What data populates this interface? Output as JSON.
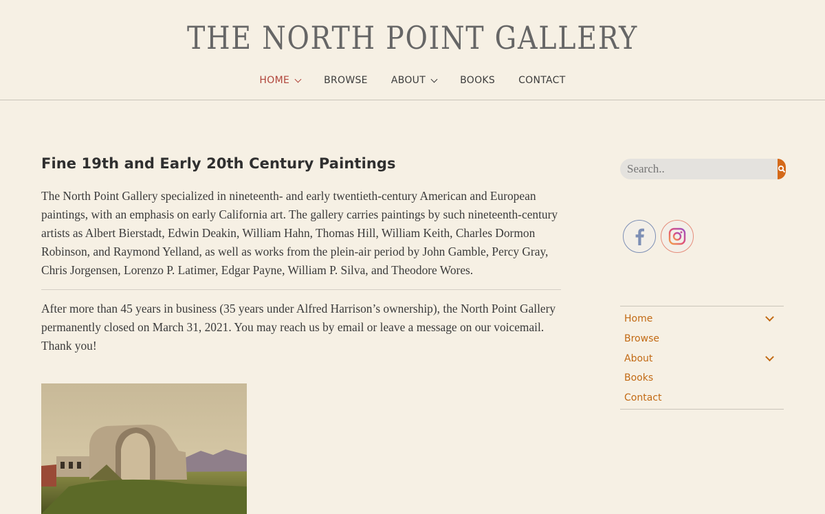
{
  "site": {
    "title": "THE NORTH POINT GALLERY"
  },
  "nav": {
    "items": [
      {
        "label": "HOME",
        "active": true,
        "dropdown": true
      },
      {
        "label": "BROWSE",
        "active": false,
        "dropdown": false
      },
      {
        "label": "ABOUT",
        "active": false,
        "dropdown": true
      },
      {
        "label": "BOOKS",
        "active": false,
        "dropdown": false
      },
      {
        "label": "CONTACT",
        "active": false,
        "dropdown": false
      }
    ]
  },
  "main": {
    "title": "Fine 19th and Early 20th Century Paintings",
    "paragraph1": "The North Point Gallery specialized in nineteenth- and early twentieth-century American and European paintings, with an emphasis on early California art. The gallery carries paintings by such nineteenth-century artists as Albert Bierstadt, Edwin Deakin, William Hahn, Thomas Hill, William Keith, Charles Dormon Robinson, and Raymond Yelland, as well as works from the plein-air period by John Gamble, Percy Gray, Chris Jorgensen, Lorenzo P. Latimer, Edgar Payne, William P. Silva, and Theodore Wores.",
    "paragraph2": "After more than 45 years in business (35 years under Alfred Harrison’s ownership), the North Point Gallery permanently closed on March 31, 2021.  You may reach us by email or leave a message on our voicemail. Thank you!"
  },
  "sidebar": {
    "search": {
      "placeholder": "Search.."
    },
    "social": [
      {
        "icon": "facebook-icon"
      },
      {
        "icon": "instagram-icon"
      }
    ],
    "menu": [
      {
        "label": "Home",
        "expandable": true
      },
      {
        "label": "Browse",
        "expandable": false
      },
      {
        "label": "About",
        "expandable": true
      },
      {
        "label": "Books",
        "expandable": false
      },
      {
        "label": "Contact",
        "expandable": false
      }
    ]
  },
  "colors": {
    "background": "#f6f0e4",
    "accent": "#d4691a",
    "active_nav": "#b0443a",
    "sidebar_link": "#c26a14"
  }
}
